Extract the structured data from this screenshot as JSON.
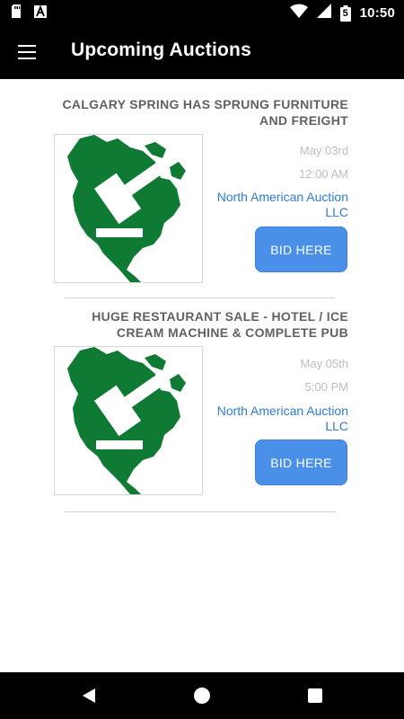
{
  "status": {
    "time": "10:50",
    "battery_level": "5",
    "left_icons": [
      "sd-card-icon",
      "a-icon"
    ],
    "right_icons": [
      "wifi-icon",
      "signal-icon",
      "battery-icon"
    ]
  },
  "app_bar": {
    "title": "Upcoming Auctions",
    "menu_icon": "hamburger-menu-icon"
  },
  "auctions": [
    {
      "title": "CALGARY SPRING HAS SPRUNG FURNITURE AND FREIGHT",
      "date": "May 03rd",
      "time": "12:00 AM",
      "company": "North American Auction LLC",
      "button": "BID HERE",
      "image": "north-america-gavel-logo"
    },
    {
      "title": "HUGE RESTAURANT SALE - HOTEL / ICE CREAM MACHINE & COMPLETE PUB",
      "date": "May 05th",
      "time": "5:00 PM",
      "company": "North American Auction LLC",
      "button": "BID HERE",
      "image": "north-america-gavel-logo"
    }
  ],
  "colors": {
    "app_bar": "#000000",
    "title_text": "#616161",
    "meta_text": "#bdbdbd",
    "company_link": "#2f7bd8",
    "button": "#4a90e8",
    "logo_green": "#0f7a33"
  },
  "nav": {
    "back": "back-triangle-icon",
    "home": "home-circle-icon",
    "recent": "recent-apps-square-icon"
  }
}
